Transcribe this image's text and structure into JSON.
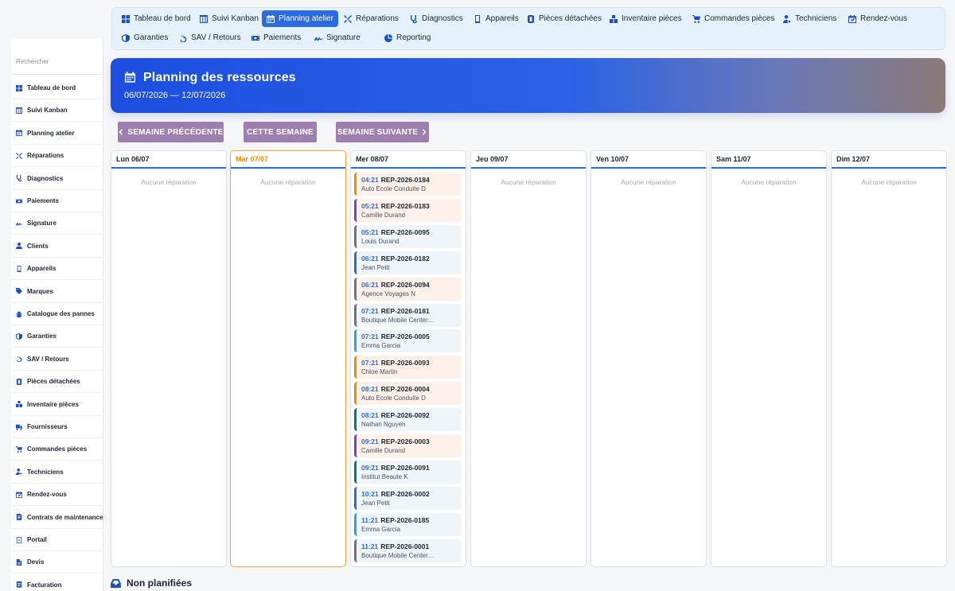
{
  "colors": {
    "accent": "#2b6be0",
    "today": "#f08c00",
    "button": "#9d7fb0"
  },
  "sidebar": {
    "search_label": "Rechercher",
    "items": [
      {
        "label": "Tableau de bord",
        "icon": "dashboard-icon"
      },
      {
        "label": "Suivi Kanban",
        "icon": "kanban-icon"
      },
      {
        "label": "Planning atelier",
        "icon": "calendar-icon"
      },
      {
        "label": "Réparations",
        "icon": "tools-icon"
      },
      {
        "label": "Diagnostics",
        "icon": "stethoscope-icon"
      },
      {
        "label": "Paiements",
        "icon": "money-icon"
      },
      {
        "label": "Signature",
        "icon": "signature-icon"
      },
      {
        "label": "Clients",
        "icon": "user-icon"
      },
      {
        "label": "Appareils",
        "icon": "phone-icon"
      },
      {
        "label": "Marques",
        "icon": "tag-icon"
      },
      {
        "label": "Catalogue des pannes",
        "icon": "bug-icon"
      },
      {
        "label": "Garanties",
        "icon": "shield-icon"
      },
      {
        "label": "SAV / Retours",
        "icon": "undo-icon"
      },
      {
        "label": "Pièces détachées",
        "icon": "parts-icon"
      },
      {
        "label": "Inventaire pièces",
        "icon": "boxes-icon"
      },
      {
        "label": "Fournisseurs",
        "icon": "truck-icon"
      },
      {
        "label": "Commandes pièces",
        "icon": "cart-icon"
      },
      {
        "label": "Techniciens",
        "icon": "user-gear-icon"
      },
      {
        "label": "Rendez-vous",
        "icon": "calendar-check-icon"
      },
      {
        "label": "Contrats de maintenance",
        "icon": "contract-icon"
      },
      {
        "label": "Portail",
        "icon": "portal-icon"
      },
      {
        "label": "Devis",
        "icon": "file-icon"
      },
      {
        "label": "Facturation",
        "icon": "invoice-icon"
      }
    ]
  },
  "topnav": {
    "row1": [
      {
        "label": "Tableau de bord",
        "icon": "dashboard-icon"
      },
      {
        "label": "Suivi Kanban",
        "icon": "kanban-icon"
      },
      {
        "label": "Planning atelier",
        "icon": "calendar-icon",
        "active": true
      },
      {
        "label": "Réparations",
        "icon": "tools-icon"
      },
      {
        "label": "Diagnostics",
        "icon": "stethoscope-icon"
      },
      {
        "label": "Appareils",
        "icon": "phone-icon"
      },
      {
        "label": "Pièces détachées",
        "icon": "parts-icon"
      },
      {
        "label": "Inventaire pièces",
        "icon": "boxes-icon"
      },
      {
        "label": "Commandes pièces",
        "icon": "cart-icon"
      },
      {
        "label": "Techniciens",
        "icon": "user-gear-icon"
      },
      {
        "label": "Rendez-vous",
        "icon": "calendar-check-icon"
      }
    ],
    "row2": [
      {
        "label": "Garanties",
        "icon": "shield-icon"
      },
      {
        "label": "SAV / Retours",
        "icon": "undo-icon"
      },
      {
        "label": "Paiements",
        "icon": "money-icon"
      },
      {
        "label": "Signature",
        "icon": "signature-icon"
      },
      {
        "label": "Reporting",
        "icon": "chart-pie-icon"
      }
    ]
  },
  "hero": {
    "title": "Planning des ressources",
    "range": "06/07/2026 — 12/07/2026"
  },
  "week_nav": {
    "prev": "SEMAINE PRÉCÉDENTE",
    "current": "CETTE SEMAINE",
    "next": "SEMAINE SUIVANTE"
  },
  "days": [
    {
      "label": "Lun 06/07",
      "today": false,
      "empty": "Aucune réparation",
      "cards": []
    },
    {
      "label": "Mar 07/07",
      "today": true,
      "empty": "Aucune réparation",
      "cards": []
    },
    {
      "label": "Mer 08/07",
      "today": false,
      "empty": "",
      "cards": [
        {
          "time": "04:21",
          "ref": "REP-2026-0184",
          "client": "Auto Ecole Conduite D",
          "color": "#f08c00",
          "bg": "#fdf1ea"
        },
        {
          "time": "05:21",
          "ref": "REP-2026-0183",
          "client": "Camille Durand",
          "color": "#7b3fc4",
          "bg": "#fdf1ea"
        },
        {
          "time": "05:21",
          "ref": "REP-2026-0095",
          "client": "Louis Durand",
          "color": "#6b7280",
          "bg": "#f0f5fa"
        },
        {
          "time": "06:21",
          "ref": "REP-2026-0182",
          "client": "Jean Petit",
          "color": "#2b6be0",
          "bg": "#f0f5fa"
        },
        {
          "time": "06:21",
          "ref": "REP-2026-0094",
          "client": "Agence Voyages N",
          "color": "#6b7280",
          "bg": "#fdf1ea"
        },
        {
          "time": "07:21",
          "ref": "REP-2026-0181",
          "client": "Boutique Mobile Center…",
          "color": "#6b7280",
          "bg": "#f0f5fa"
        },
        {
          "time": "07:21",
          "ref": "REP-2026-0005",
          "client": "Emma Garcia",
          "color": "#2aa3d6",
          "bg": "#f0f5fa"
        },
        {
          "time": "07:21",
          "ref": "REP-2026-0093",
          "client": "Chloe Martin",
          "color": "#f08c00",
          "bg": "#fdf1ea"
        },
        {
          "time": "08:21",
          "ref": "REP-2026-0004",
          "client": "Auto Ecole Conduite D",
          "color": "#f08c00",
          "bg": "#fdf1ea"
        },
        {
          "time": "08:21",
          "ref": "REP-2026-0092",
          "client": "Nathan Nguyen",
          "color": "#0f766e",
          "bg": "#f0f5fa"
        },
        {
          "time": "09:21",
          "ref": "REP-2026-0003",
          "client": "Camille Durand",
          "color": "#7b3fc4",
          "bg": "#fdf1ea"
        },
        {
          "time": "09:21",
          "ref": "REP-2026-0091",
          "client": "Institut Beaute K",
          "color": "#0f766e",
          "bg": "#f0f5fa"
        },
        {
          "time": "10:21",
          "ref": "REP-2026-0002",
          "client": "Jean Petit",
          "color": "#2b6be0",
          "bg": "#f0f5fa"
        },
        {
          "time": "11:21",
          "ref": "REP-2026-0185",
          "client": "Emma Garcia",
          "color": "#2aa3d6",
          "bg": "#f0f5fa"
        },
        {
          "time": "11:21",
          "ref": "REP-2026-0001",
          "client": "Boutique Mobile Center…",
          "color": "#6b7280",
          "bg": "#f0f5fa"
        }
      ]
    },
    {
      "label": "Jeu 09/07",
      "today": false,
      "empty": "Aucune réparation",
      "cards": []
    },
    {
      "label": "Ven 10/07",
      "today": false,
      "empty": "Aucune réparation",
      "cards": []
    },
    {
      "label": "Sam 11/07",
      "today": false,
      "empty": "Aucune réparation",
      "cards": []
    },
    {
      "label": "Dim 12/07",
      "today": false,
      "empty": "Aucune réparation",
      "cards": []
    }
  ],
  "unplanned": {
    "title": "Non planifiées",
    "icon": "inbox-icon"
  }
}
